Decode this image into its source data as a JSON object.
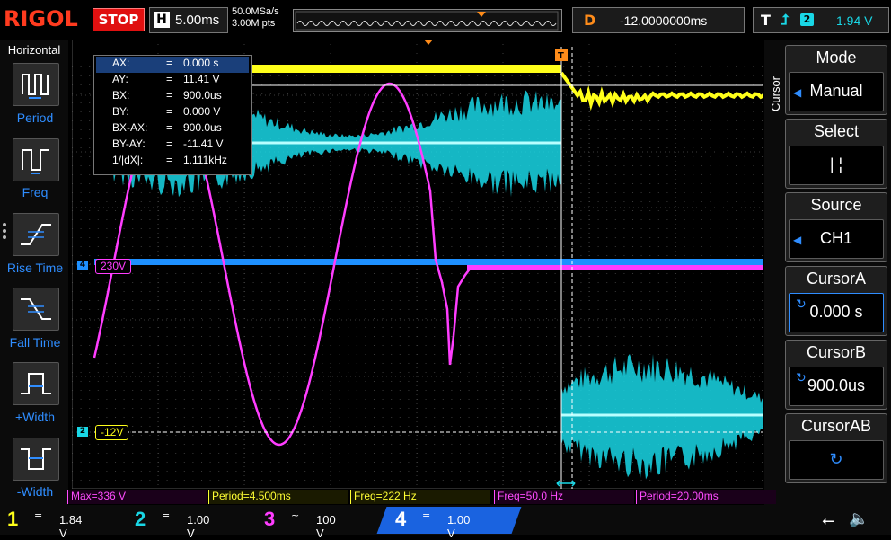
{
  "brand": "RIGOL",
  "run_state": "STOP",
  "horizontal": {
    "key": "H",
    "timebase": "5.00ms",
    "sample_rate": "50.0MSa/s",
    "memory": "3.00M pts"
  },
  "delay": {
    "key": "D",
    "value": "-12.0000000ms"
  },
  "trigger": {
    "key": "T",
    "edge_icon": "rising-edge-icon",
    "source": "2",
    "level": "1.94 V"
  },
  "left_menu": {
    "title": "Horizontal",
    "items": [
      {
        "label": "Period",
        "icon": "period-icon"
      },
      {
        "label": "Freq",
        "icon": "freq-icon"
      },
      {
        "label": "Rise Time",
        "icon": "rise-time-icon"
      },
      {
        "label": "Fall Time",
        "icon": "fall-time-icon"
      },
      {
        "label": "+Width",
        "icon": "positive-width-icon"
      },
      {
        "label": "-Width",
        "icon": "negative-width-icon"
      }
    ]
  },
  "right_menu": {
    "category": "Cursor",
    "items": [
      {
        "title": "Mode",
        "value": "Manual"
      },
      {
        "title": "Select",
        "value": "|  ¦"
      },
      {
        "title": "Source",
        "value": "CH1"
      },
      {
        "title": "CursorA",
        "value": "0.000 s"
      },
      {
        "title": "CursorB",
        "value": "900.0us"
      },
      {
        "title": "CursorAB",
        "value": "↻"
      }
    ]
  },
  "cursor_readout": [
    {
      "label": "AX:",
      "value": "0.000 s"
    },
    {
      "label": "AY:",
      "value": "11.41 V"
    },
    {
      "label": "BX:",
      "value": "900.0us"
    },
    {
      "label": "BY:",
      "value": "0.000 V"
    },
    {
      "label": "BX-AX:",
      "value": "900.0us"
    },
    {
      "label": "BY-AY:",
      "value": "-11.41 V"
    },
    {
      "label": "1/|dX|:",
      "value": "1.111kHz"
    }
  ],
  "channel_levels": {
    "ch3": "230V",
    "ch1": "-12V"
  },
  "channel_tags": {
    "ch4": "4",
    "ch2": "2",
    "trigger": "T"
  },
  "measurements": [
    {
      "text": "Max=336 V",
      "color": "#ff4cff"
    },
    {
      "text": "Period=4.500ms",
      "color": "#ffff33"
    },
    {
      "text": "Freq=222 Hz",
      "color": "#ffff33"
    },
    {
      "text": "Freq=50.0 Hz",
      "color": "#ff4cff"
    },
    {
      "text": "Period=20.00ms",
      "color": "#ff4cff"
    }
  ],
  "channels": [
    {
      "num": "1",
      "coupling": "=",
      "scale": "1.84 V",
      "color": "#ffff1a"
    },
    {
      "num": "2",
      "coupling": "=",
      "scale": "1.00 V",
      "color": "#19d7e6"
    },
    {
      "num": "3",
      "coupling": "~",
      "scale": "100 V",
      "color": "#ff3dff"
    },
    {
      "num": "4",
      "coupling": "=",
      "scale": "1.00 V",
      "color": "#2f8dff"
    }
  ],
  "status_icons": [
    "usb-icon",
    "speaker-muted-icon"
  ],
  "colors": {
    "ch1": "#ffff1a",
    "ch2": "#19d7e6",
    "ch3": "#ff3dff",
    "ch4": "#1e90ff",
    "accent": "#ff8c1a"
  }
}
